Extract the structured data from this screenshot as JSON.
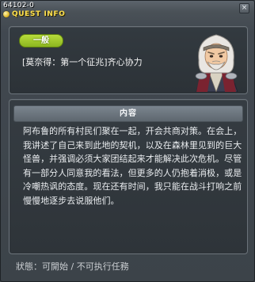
{
  "header": {
    "quest_id": "64102-0",
    "title": "QUEST INFO",
    "close_label": "×"
  },
  "summary": {
    "category_badge": "一般",
    "quest_name": "[莫奈得：第一个征兆]齐心协力"
  },
  "content": {
    "section_title": "内容",
    "description": "阿布鲁的所有村民们聚在一起，开会共商对策。在会上，我讲述了自己来到此地的契机，以及在森林里见到的巨大怪兽，并强调必须大家团结起来才能解决此次危机。尽管有一部分人同意我的看法，但更多的人仍抱着消极，或是冷嘲热讽的态度。现在还有时间，我只能在战斗打响之前慢慢地逐步去说服他们。"
  },
  "footer": {
    "status_text": "狀態：可開始 / 不可执行任務"
  },
  "colors": {
    "title_yellow": "#ffe14d",
    "badge_green": "#9cc72a",
    "panel_bg": "#2e3439",
    "header_bar": "#6c757e"
  },
  "icons": {
    "title": "quest-bulb-icon",
    "npc": "npc-portrait"
  }
}
